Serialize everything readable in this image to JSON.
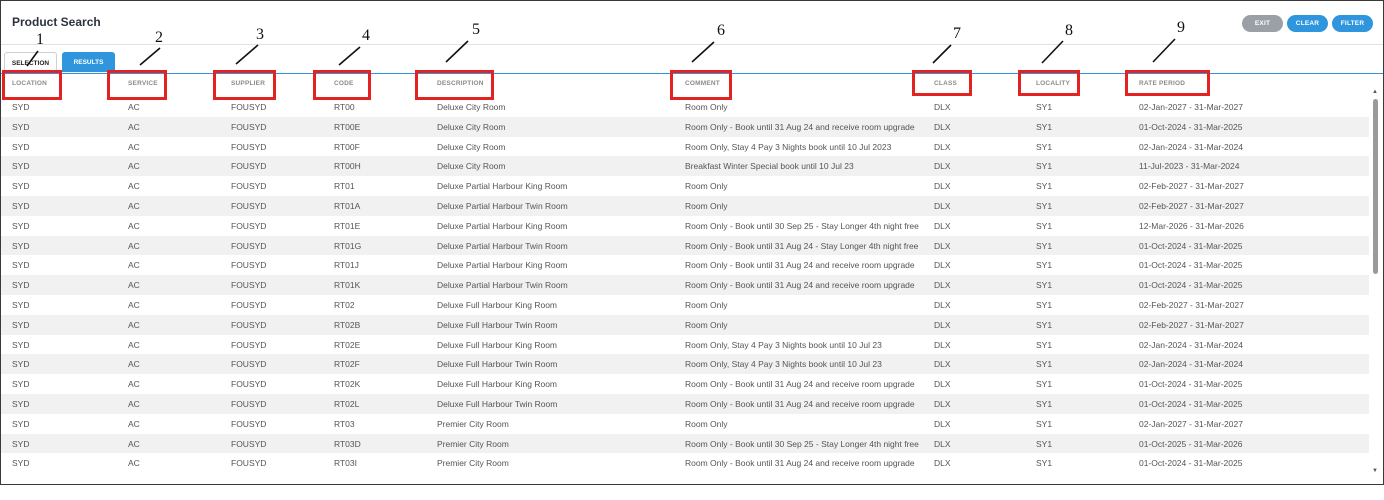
{
  "header": {
    "title": "Product Search",
    "buttons": {
      "exit": "EXIT",
      "clear": "CLEAR",
      "filter": "FILTER"
    }
  },
  "tabs": {
    "selection": "SELECTION",
    "results": "RESULTS"
  },
  "columns": [
    "LOCATION",
    "SERVICE",
    "SUPPLIER",
    "CODE",
    "DESCRIPTION",
    "COMMENT",
    "CLASS",
    "LOCALITY",
    "RATE PERIOD"
  ],
  "annotations": [
    "1",
    "2",
    "3",
    "4",
    "5",
    "6",
    "7",
    "8",
    "9"
  ],
  "rows": [
    [
      "SYD",
      "AC",
      "FOUSYD",
      "RT00",
      "Deluxe City Room",
      "Room Only",
      "DLX",
      "SY1",
      "02-Jan-2027 - 31-Mar-2027"
    ],
    [
      "SYD",
      "AC",
      "FOUSYD",
      "RT00E",
      "Deluxe City Room",
      "Room Only - Book until 31 Aug 24 and receive room upgrade",
      "DLX",
      "SY1",
      "01-Oct-2024 - 31-Mar-2025"
    ],
    [
      "SYD",
      "AC",
      "FOUSYD",
      "RT00F",
      "Deluxe City Room",
      "Room Only, Stay 4 Pay 3 Nights book until 10 Jul 2023",
      "DLX",
      "SY1",
      "02-Jan-2024 - 31-Mar-2024"
    ],
    [
      "SYD",
      "AC",
      "FOUSYD",
      "RT00H",
      "Deluxe City Room",
      "Breakfast Winter Special book until 10 Jul 23",
      "DLX",
      "SY1",
      "11-Jul-2023 - 31-Mar-2024"
    ],
    [
      "SYD",
      "AC",
      "FOUSYD",
      "RT01",
      "Deluxe Partial Harbour King Room",
      "Room Only",
      "DLX",
      "SY1",
      "02-Feb-2027 - 31-Mar-2027"
    ],
    [
      "SYD",
      "AC",
      "FOUSYD",
      "RT01A",
      "Deluxe Partial Harbour Twin Room",
      "Room Only",
      "DLX",
      "SY1",
      "02-Feb-2027 - 31-Mar-2027"
    ],
    [
      "SYD",
      "AC",
      "FOUSYD",
      "RT01E",
      "Deluxe Partial Harbour King Room",
      "Room Only - Book until 30 Sep 25 - Stay Longer 4th night free",
      "DLX",
      "SY1",
      "12-Mar-2026 - 31-Mar-2026"
    ],
    [
      "SYD",
      "AC",
      "FOUSYD",
      "RT01G",
      "Deluxe Partial Harbour Twin Room",
      "Room Only - Book until 31 Aug 24 - Stay Longer 4th night free",
      "DLX",
      "SY1",
      "01-Oct-2024 - 31-Mar-2025"
    ],
    [
      "SYD",
      "AC",
      "FOUSYD",
      "RT01J",
      "Deluxe Partial Harbour King Room",
      "Room Only - Book until 31 Aug 24 and receive room upgrade",
      "DLX",
      "SY1",
      "01-Oct-2024 - 31-Mar-2025"
    ],
    [
      "SYD",
      "AC",
      "FOUSYD",
      "RT01K",
      "Deluxe Partial Harbour Twin Room",
      "Room Only - Book until 31 Aug 24 and receive room upgrade",
      "DLX",
      "SY1",
      "01-Oct-2024 - 31-Mar-2025"
    ],
    [
      "SYD",
      "AC",
      "FOUSYD",
      "RT02",
      "Deluxe Full Harbour King Room",
      "Room Only",
      "DLX",
      "SY1",
      "02-Feb-2027 - 31-Mar-2027"
    ],
    [
      "SYD",
      "AC",
      "FOUSYD",
      "RT02B",
      "Deluxe Full Harbour Twin Room",
      "Room Only",
      "DLX",
      "SY1",
      "02-Feb-2027 - 31-Mar-2027"
    ],
    [
      "SYD",
      "AC",
      "FOUSYD",
      "RT02E",
      "Deluxe Full Harbour King Room",
      "Room Only, Stay 4 Pay 3 Nights book until 10 Jul 23",
      "DLX",
      "SY1",
      "02-Jan-2024 - 31-Mar-2024"
    ],
    [
      "SYD",
      "AC",
      "FOUSYD",
      "RT02F",
      "Deluxe Full Harbour Twin Room",
      "Room Only, Stay 4 Pay 3 Nights book until 10 Jul 23",
      "DLX",
      "SY1",
      "02-Jan-2024 - 31-Mar-2024"
    ],
    [
      "SYD",
      "AC",
      "FOUSYD",
      "RT02K",
      "Deluxe Full Harbour King Room",
      "Room Only - Book until 31 Aug 24 and receive room upgrade",
      "DLX",
      "SY1",
      "01-Oct-2024 - 31-Mar-2025"
    ],
    [
      "SYD",
      "AC",
      "FOUSYD",
      "RT02L",
      "Deluxe Full Harbour Twin Room",
      "Room Only - Book until 31 Aug 24 and receive room upgrade",
      "DLX",
      "SY1",
      "01-Oct-2024 - 31-Mar-2025"
    ],
    [
      "SYD",
      "AC",
      "FOUSYD",
      "RT03",
      "Premier City Room",
      "Room Only",
      "DLX",
      "SY1",
      "02-Jan-2027 - 31-Mar-2027"
    ],
    [
      "SYD",
      "AC",
      "FOUSYD",
      "RT03D",
      "Premier City Room",
      "Room Only - Book until 30 Sep 25 - Stay Longer 4th night free",
      "DLX",
      "SY1",
      "01-Oct-2025 - 31-Mar-2026"
    ],
    [
      "SYD",
      "AC",
      "FOUSYD",
      "RT03I",
      "Premier City Room",
      "Room Only - Book until 31 Aug 24 and receive room upgrade",
      "DLX",
      "SY1",
      "01-Oct-2024 - 31-Mar-2025"
    ]
  ]
}
